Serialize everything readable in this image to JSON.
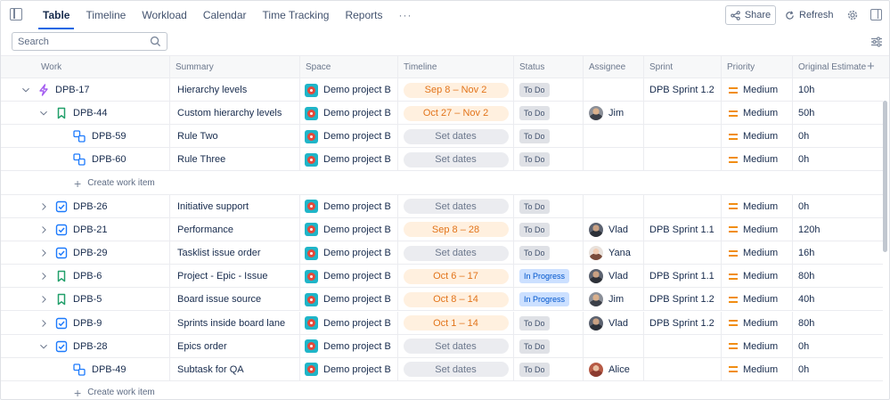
{
  "tabs": [
    {
      "label": "Table",
      "active": true
    },
    {
      "label": "Timeline",
      "active": false
    },
    {
      "label": "Workload",
      "active": false
    },
    {
      "label": "Calendar",
      "active": false
    },
    {
      "label": "Time Tracking",
      "active": false
    },
    {
      "label": "Reports",
      "active": false
    },
    {
      "label": "···",
      "active": false
    }
  ],
  "toolbar": {
    "share_label": "Share",
    "refresh_label": "Refresh"
  },
  "search": {
    "placeholder": "Search"
  },
  "columns": [
    "Work",
    "Summary",
    "Space",
    "Timeline",
    "Status",
    "Assignee",
    "Sprint",
    "Priority",
    "Original Estimate"
  ],
  "create_label": "Create work item",
  "colors": {
    "accent": "#0c66e4",
    "epic": "#a35bf0",
    "story": "#22a06b",
    "task": "#1d7afc",
    "subtask": "#1d7afc",
    "priority_medium": "#f18d13"
  },
  "rows": [
    {
      "kind": "item",
      "level": 0,
      "expand": "open",
      "type": "epic",
      "key": "DPB-17",
      "summary": "Hierarchy levels",
      "space": "Demo project B",
      "timeline": "Sep 8 – Nov 2",
      "has_dates": true,
      "status": "To Do",
      "assignee": "",
      "sprint": "DPB Sprint 1.2",
      "priority": "Medium",
      "estimate": "10h"
    },
    {
      "kind": "item",
      "level": 1,
      "expand": "open",
      "type": "story",
      "key": "DPB-44",
      "summary": "Custom hierarchy levels",
      "space": "Demo project B",
      "timeline": "Oct 27 – Nov 2",
      "has_dates": true,
      "status": "To Do",
      "assignee": "Jim",
      "sprint": "",
      "priority": "Medium",
      "estimate": "50h"
    },
    {
      "kind": "item",
      "level": 2,
      "expand": "none",
      "type": "subtask",
      "key": "DPB-59",
      "summary": "Rule Two",
      "space": "Demo project B",
      "timeline": "Set dates",
      "has_dates": false,
      "status": "To Do",
      "assignee": "",
      "sprint": "",
      "priority": "Medium",
      "estimate": "0h"
    },
    {
      "kind": "item",
      "level": 2,
      "expand": "none",
      "type": "subtask",
      "key": "DPB-60",
      "summary": "Rule Three",
      "space": "Demo project B",
      "timeline": "Set dates",
      "has_dates": false,
      "status": "To Do",
      "assignee": "",
      "sprint": "",
      "priority": "Medium",
      "estimate": "0h"
    },
    {
      "kind": "create"
    },
    {
      "kind": "item",
      "level": 1,
      "expand": "closed",
      "type": "task",
      "key": "DPB-26",
      "summary": "Initiative support",
      "space": "Demo project B",
      "timeline": "Set dates",
      "has_dates": false,
      "status": "To Do",
      "assignee": "",
      "sprint": "",
      "priority": "Medium",
      "estimate": "0h"
    },
    {
      "kind": "item",
      "level": 1,
      "expand": "closed",
      "type": "task",
      "key": "DPB-21",
      "summary": "Performance",
      "space": "Demo project B",
      "timeline": "Sep 8 – 28",
      "has_dates": true,
      "status": "To Do",
      "assignee": "Vlad",
      "sprint": "DPB Sprint 1.1",
      "priority": "Medium",
      "estimate": "120h"
    },
    {
      "kind": "item",
      "level": 1,
      "expand": "closed",
      "type": "task",
      "key": "DPB-29",
      "summary": "Tasklist issue order",
      "space": "Demo project B",
      "timeline": "Set dates",
      "has_dates": false,
      "status": "To Do",
      "assignee": "Yana",
      "sprint": "",
      "priority": "Medium",
      "estimate": "16h"
    },
    {
      "kind": "item",
      "level": 1,
      "expand": "closed",
      "type": "story",
      "key": "DPB-6",
      "summary": "Project - Epic - Issue",
      "space": "Demo project B",
      "timeline": "Oct 6 – 17",
      "has_dates": true,
      "status": "In Progress",
      "assignee": "Vlad",
      "sprint": "DPB Sprint 1.1",
      "priority": "Medium",
      "estimate": "80h"
    },
    {
      "kind": "item",
      "level": 1,
      "expand": "closed",
      "type": "story",
      "key": "DPB-5",
      "summary": "Board issue source",
      "space": "Demo project B",
      "timeline": "Oct 8 – 14",
      "has_dates": true,
      "status": "In Progress",
      "assignee": "Jim",
      "sprint": "DPB Sprint 1.2",
      "priority": "Medium",
      "estimate": "40h"
    },
    {
      "kind": "item",
      "level": 1,
      "expand": "closed",
      "type": "task",
      "key": "DPB-9",
      "summary": "Sprints inside board lane",
      "space": "Demo project B",
      "timeline": "Oct 1 – 14",
      "has_dates": true,
      "status": "To Do",
      "assignee": "Vlad",
      "sprint": "DPB Sprint 1.2",
      "priority": "Medium",
      "estimate": "80h"
    },
    {
      "kind": "item",
      "level": 1,
      "expand": "open",
      "type": "task",
      "key": "DPB-28",
      "summary": "Epics order",
      "space": "Demo project B",
      "timeline": "Set dates",
      "has_dates": false,
      "status": "To Do",
      "assignee": "",
      "sprint": "",
      "priority": "Medium",
      "estimate": "0h"
    },
    {
      "kind": "item",
      "level": 2,
      "expand": "none",
      "type": "subtask",
      "key": "DPB-49",
      "summary": "Subtask for QA",
      "space": "Demo project B",
      "timeline": "Set dates",
      "has_dates": false,
      "status": "To Do",
      "assignee": "Alice",
      "sprint": "",
      "priority": "Medium",
      "estimate": "0h"
    },
    {
      "kind": "create"
    }
  ]
}
